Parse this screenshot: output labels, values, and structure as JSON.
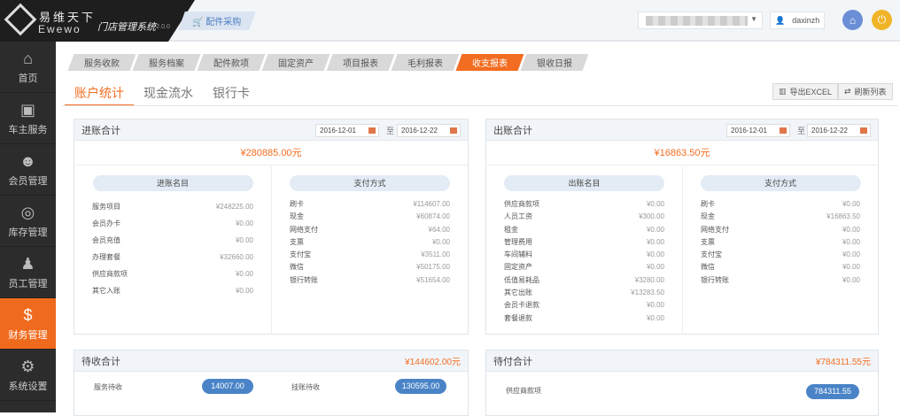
{
  "header": {
    "brand_cn": "易维天下",
    "brand_en": "Ewewo",
    "system": "门店管理系统",
    "version": "T2.0.0",
    "purchase": "配件采购",
    "username": "daxinzh"
  },
  "sidebar": [
    {
      "label": "首页",
      "icon": "⌂"
    },
    {
      "label": "车主服务",
      "icon": "▣"
    },
    {
      "label": "会员管理",
      "icon": "☻"
    },
    {
      "label": "库存管理",
      "icon": "◎"
    },
    {
      "label": "员工管理",
      "icon": "♟"
    },
    {
      "label": "财务管理",
      "icon": "$"
    },
    {
      "label": "系统设置",
      "icon": "⚙"
    }
  ],
  "tabs": [
    "服务收款",
    "服务档案",
    "配件款项",
    "固定资产",
    "项目报表",
    "毛利报表",
    "收支报表",
    "银收日报"
  ],
  "subtabs": [
    "账户统计",
    "现金流水",
    "银行卡"
  ],
  "buttons": {
    "export": "导出EXCEL",
    "refresh": "刷新列表"
  },
  "income": {
    "title": "进账合计",
    "date_from": "2016-12-01",
    "to": "至",
    "date_to": "2016-12-22",
    "total": "¥280885.00元",
    "items_title": "进账名目",
    "items": [
      [
        "服务项目",
        "¥248225.00"
      ],
      [
        "会员办卡",
        "¥0.00"
      ],
      [
        "会员充值",
        "¥0.00"
      ],
      [
        "办理套餐",
        "¥32660.00"
      ],
      [
        "供应商款项",
        "¥0.00"
      ],
      [
        "其它入账",
        "¥0.00"
      ]
    ],
    "pay_title": "支付方式",
    "pay": [
      [
        "刷卡",
        "¥114607.00"
      ],
      [
        "现金",
        "¥60874.00"
      ],
      [
        "网络支付",
        "¥64.00"
      ],
      [
        "支票",
        "¥0.00"
      ],
      [
        "支付宝",
        "¥3511.00"
      ],
      [
        "微信",
        "¥50175.00"
      ],
      [
        "银行转账",
        "¥51654.00"
      ]
    ]
  },
  "expense": {
    "title": "出账合计",
    "date_from": "2016-12-01",
    "to": "至",
    "date_to": "2016-12-22",
    "total": "¥16863.50元",
    "items_title": "出账名目",
    "items": [
      [
        "供应商款项",
        "¥0.00"
      ],
      [
        "人员工资",
        "¥300.00"
      ],
      [
        "租金",
        "¥0.00"
      ],
      [
        "管理费用",
        "¥0.00"
      ],
      [
        "车间辅料",
        "¥0.00"
      ],
      [
        "固定资产",
        "¥0.00"
      ],
      [
        "低值易耗品",
        "¥3280.00"
      ],
      [
        "其它出账",
        "¥13283.50"
      ],
      [
        "会员卡退款",
        "¥0.00"
      ],
      [
        "套餐退款",
        "¥0.00"
      ]
    ],
    "pay_title": "支付方式",
    "pay": [
      [
        "刷卡",
        "¥0.00"
      ],
      [
        "现金",
        "¥16863.50"
      ],
      [
        "网络支付",
        "¥0.00"
      ],
      [
        "支票",
        "¥0.00"
      ],
      [
        "支付宝",
        "¥0.00"
      ],
      [
        "微信",
        "¥0.00"
      ],
      [
        "银行转账",
        "¥0.00"
      ]
    ]
  },
  "receivable": {
    "title": "待收合计",
    "total": "¥144602.00元",
    "service_label": "服务待收",
    "service_value": "14007.00",
    "credit_label": "挂账待收",
    "credit_value": "130595.00"
  },
  "payable": {
    "title": "待付合计",
    "total": "¥784311.55元",
    "supplier_label": "供应商款项",
    "supplier_value": "784311.55"
  }
}
